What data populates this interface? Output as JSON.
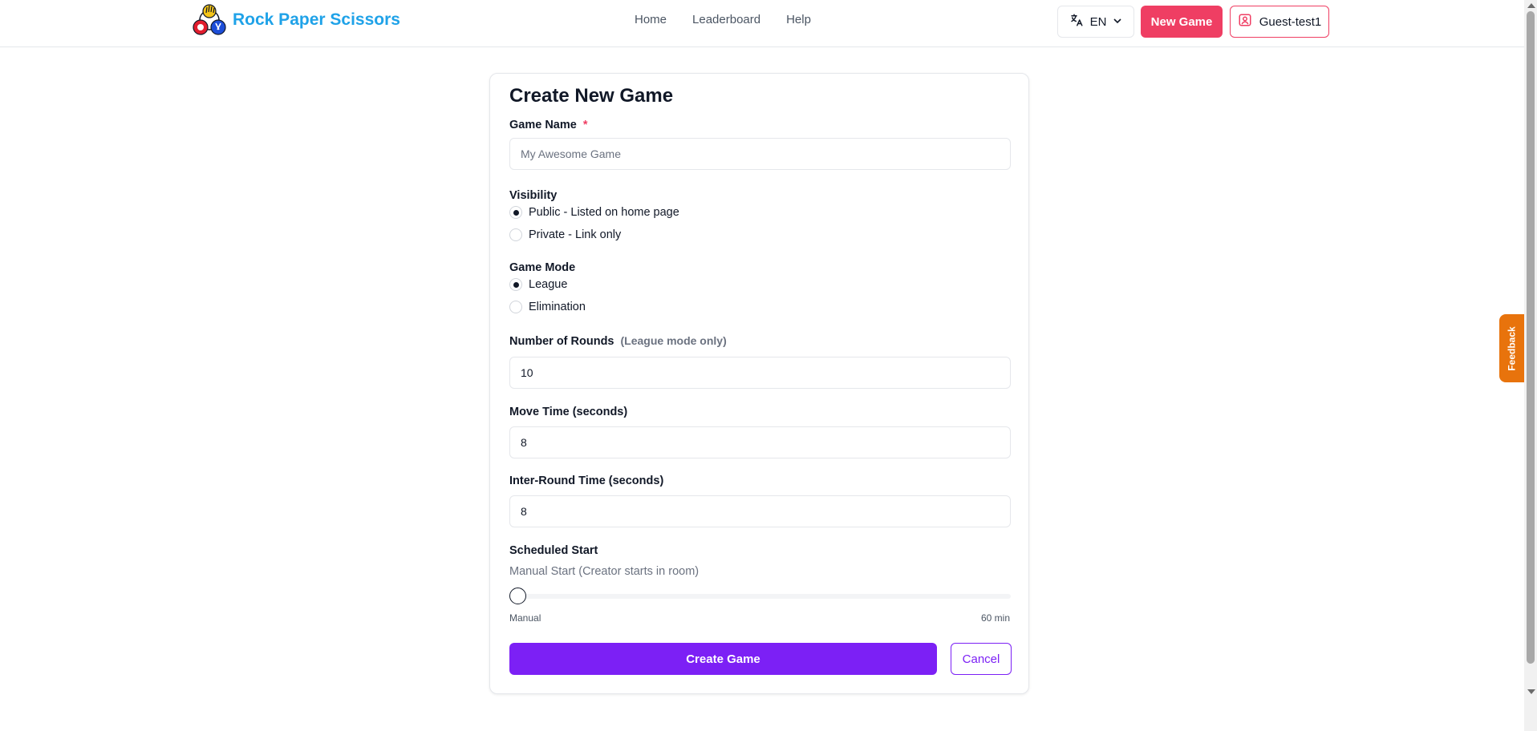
{
  "header": {
    "brand": "Rock Paper Scissors",
    "nav": [
      {
        "label": "Home"
      },
      {
        "label": "Leaderboard"
      },
      {
        "label": "Help"
      }
    ],
    "language": "EN",
    "new_game_label": "New Game",
    "user_label": "Guest-test1"
  },
  "form": {
    "title": "Create New Game",
    "game_name": {
      "label": "Game Name",
      "required_mark": "*",
      "value": "",
      "placeholder": "My Awesome Game"
    },
    "visibility": {
      "label": "Visibility",
      "options": [
        {
          "label": "Public - Listed on home page",
          "checked": true
        },
        {
          "label": "Private - Link only",
          "checked": false
        }
      ]
    },
    "game_mode": {
      "label": "Game Mode",
      "options": [
        {
          "label": "League",
          "checked": true
        },
        {
          "label": "Elimination",
          "checked": false
        }
      ]
    },
    "rounds": {
      "label": "Number of Rounds",
      "hint": "(League mode only)",
      "value": "10"
    },
    "move_time": {
      "label": "Move Time (seconds)",
      "value": "8"
    },
    "inter_round_time": {
      "label": "Inter-Round Time (seconds)",
      "value": "8"
    },
    "scheduled_start": {
      "label": "Scheduled Start",
      "description": "Manual Start (Creator starts in room)",
      "slider_value": 0,
      "slider_min_label": "Manual",
      "slider_max_label": "60 min"
    },
    "create_label": "Create Game",
    "cancel_label": "Cancel"
  },
  "feedback_label": "Feedback",
  "colors": {
    "brand": "#1fa2e8",
    "new_game": "#ef3e63",
    "primary": "#7c20f5",
    "feedback": "#e8730c"
  }
}
